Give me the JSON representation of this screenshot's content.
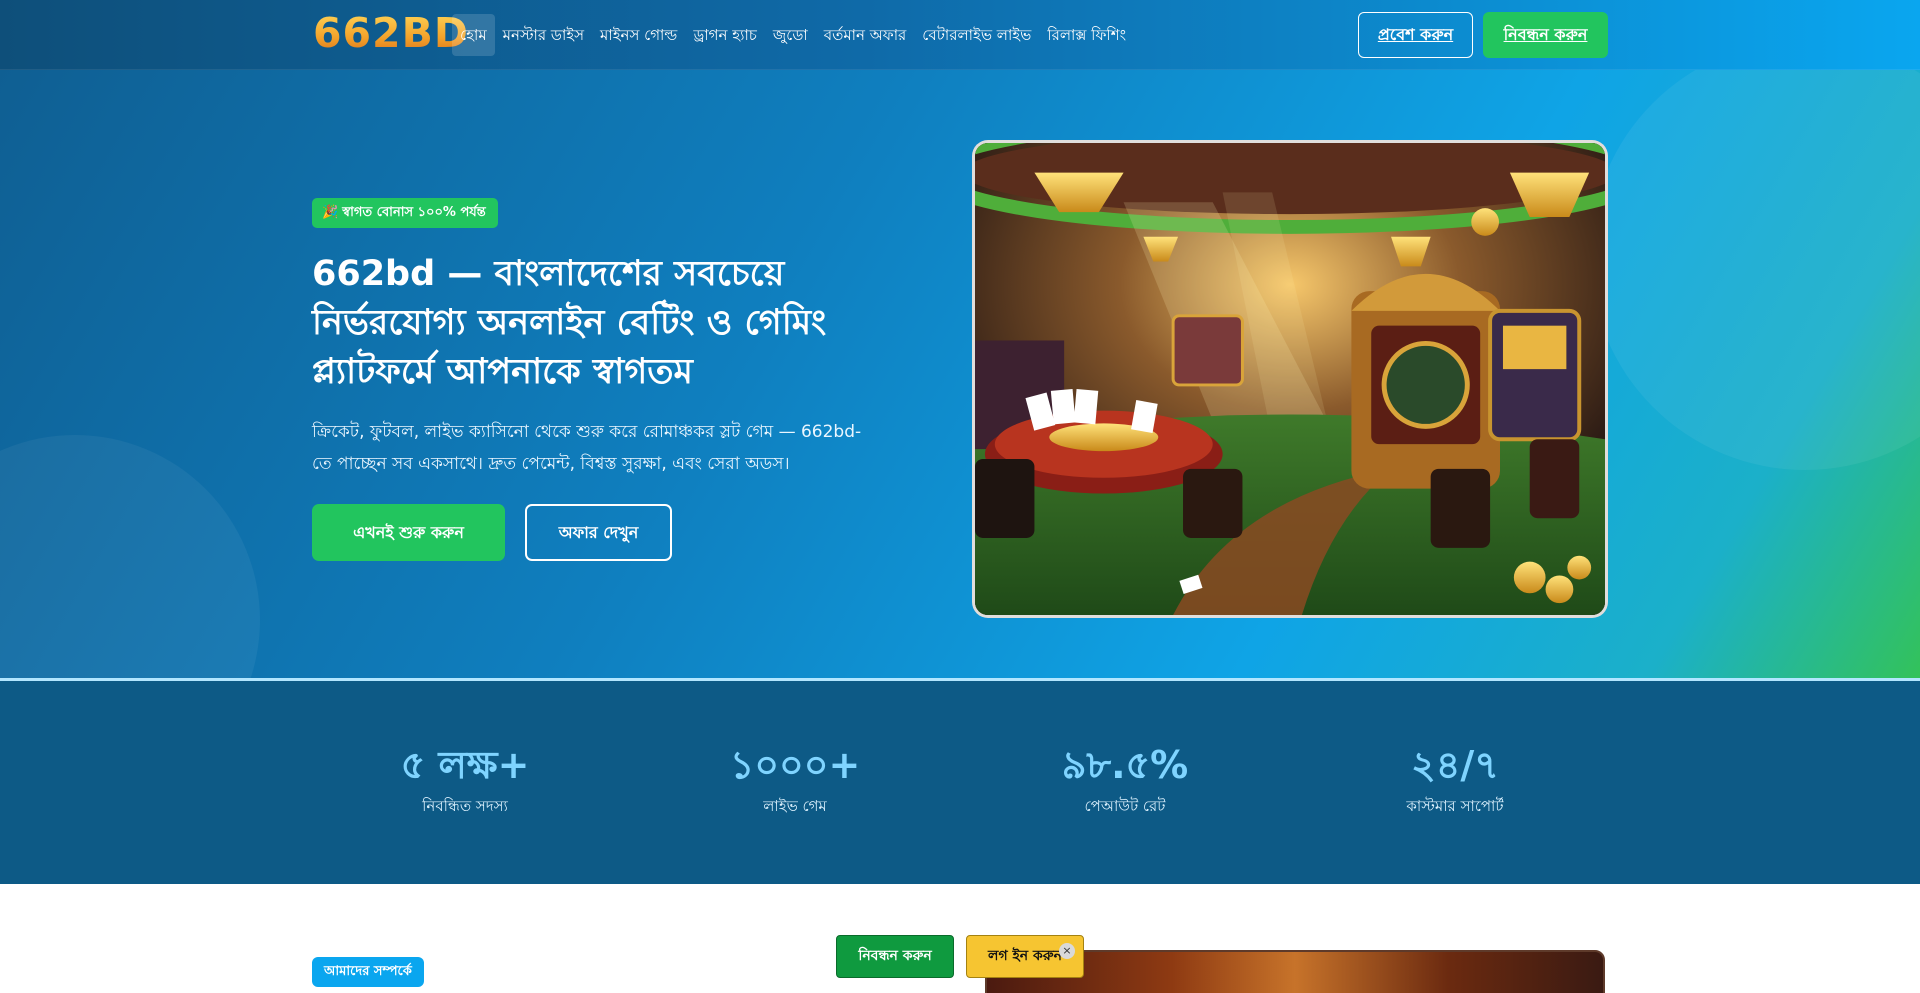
{
  "header": {
    "logo": "662BD",
    "nav": [
      {
        "label": "হোম"
      },
      {
        "label": "মনস্টার ডাইস"
      },
      {
        "label": "মাইনস গোল্ড"
      },
      {
        "label": "ড্রাগন হ্যাচ"
      },
      {
        "label": "জুডো"
      },
      {
        "label": "বর্তমান অফার"
      },
      {
        "label": "বেটারলাইভ লাইভ"
      },
      {
        "label": "রিলাক্স ফিশিং"
      }
    ],
    "login_label": "প্রবেশ করুন",
    "register_label": "নিবন্ধন করুন"
  },
  "hero": {
    "badge_icon": "🎉",
    "badge": "স্বাগত বোনাস ১০০% পর্যন্ত",
    "title": "662bd — বাংলাদেশের সবচেয়ে নির্ভরযোগ্য অনলাইন বেটিং ও গেমিং প্ল্যাটফর্মে আপনাকে স্বাগতম",
    "description": "ক্রিকেট, ফুটবল, লাইভ ক্যাসিনো থেকে শুরু করে রোমাঞ্চকর স্লট গেম — 662bd-তে পাচ্ছেন সব একসাথে। দ্রুত পেমেন্ট, বিশ্বস্ত সুরক্ষা, এবং সেরা অডস।",
    "cta_start": "এখনই শুরু করুন",
    "cta_offer": "অফার দেখুন"
  },
  "stats": [
    {
      "value": "৫ লক্ষ+",
      "label": "নিবন্ধিত সদস্য"
    },
    {
      "value": "১০০০+",
      "label": "লাইভ গেম"
    },
    {
      "value": "৯৮.৫%",
      "label": "পেআউট রেট"
    },
    {
      "value": "২৪/৭",
      "label": "কাস্টমার সাপোর্ট"
    }
  ],
  "about": {
    "tag": "আমাদের সম্পর্কে"
  },
  "floating": {
    "register_label": "নিবন্ধন করুন",
    "login_label": "লগ ইন করুন",
    "close_icon": "×"
  },
  "colors": {
    "accent_green": "#22c55e",
    "accent_blue": "#0aa6ef",
    "stats_bg": "#0d5a86",
    "login_yellow": "#f6c531"
  }
}
